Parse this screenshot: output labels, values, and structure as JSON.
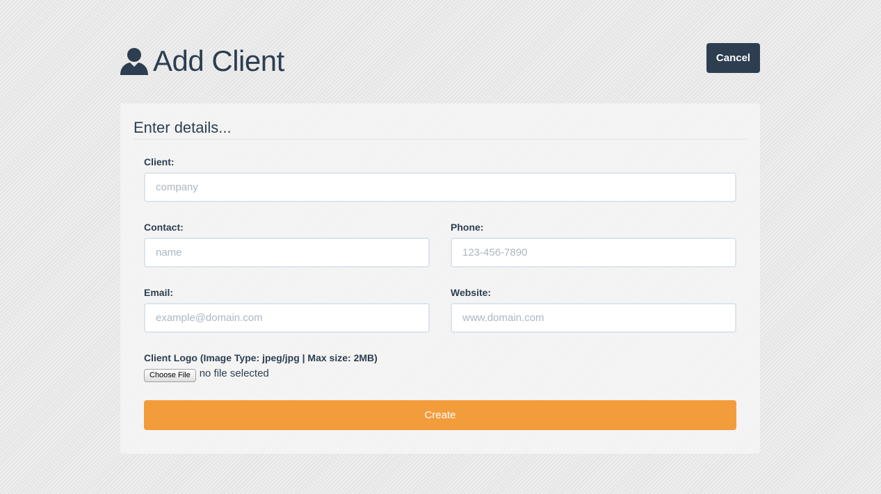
{
  "header": {
    "title": "Add Client",
    "icon": "user-icon",
    "cancel_label": "Cancel"
  },
  "form": {
    "heading": "Enter details...",
    "client": {
      "label": "Client:",
      "value": "",
      "placeholder": "company"
    },
    "contact": {
      "label": "Contact:",
      "value": "",
      "placeholder": "name"
    },
    "phone": {
      "label": "Phone:",
      "value": "",
      "placeholder": "123-456-7890"
    },
    "email": {
      "label": "Email:",
      "value": "",
      "placeholder": "example@domain.com"
    },
    "website": {
      "label": "Website:",
      "value": "",
      "placeholder": "www.domain.com"
    },
    "logo": {
      "label": "Client Logo (Image Type: jpeg/jpg | Max size: 2MB)",
      "button_label": "Choose File",
      "status": "no file selected"
    },
    "submit_label": "Create"
  },
  "colors": {
    "primary_dark": "#2c3e50",
    "accent_orange": "#f39c3c",
    "input_border": "#dce4ec",
    "placeholder": "#acb6c0"
  }
}
